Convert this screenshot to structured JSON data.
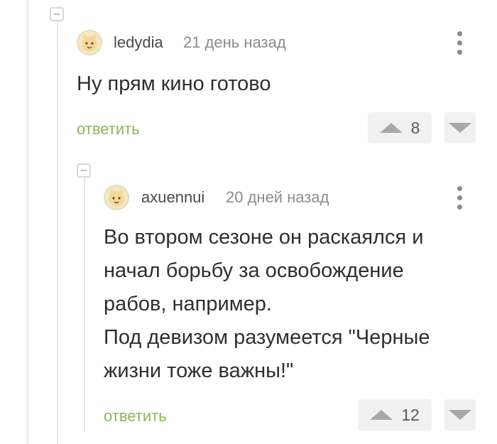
{
  "comments": [
    {
      "username": "ledydia",
      "time": "21 день назад",
      "text_lines": [
        "Ну прям кино готово"
      ],
      "reply_label": "ответить",
      "rating": "8",
      "avatar_icon": "cat-avatar"
    },
    {
      "username": "axuennui",
      "time": "20 дней назад",
      "text_lines": [
        "Во втором сезоне он раскаялся и",
        "начал борьбу за освобождение",
        "рабов, например.",
        "Под девизом разумеется \"Черные",
        "жизни тоже важны!\""
      ],
      "reply_label": "ответить",
      "rating": "12",
      "avatar_icon": "cat-avatar"
    }
  ],
  "colors": {
    "reply_link": "#8ab858",
    "thread_line": "#e6e6e6",
    "vote_bg": "#f1f1f1"
  }
}
